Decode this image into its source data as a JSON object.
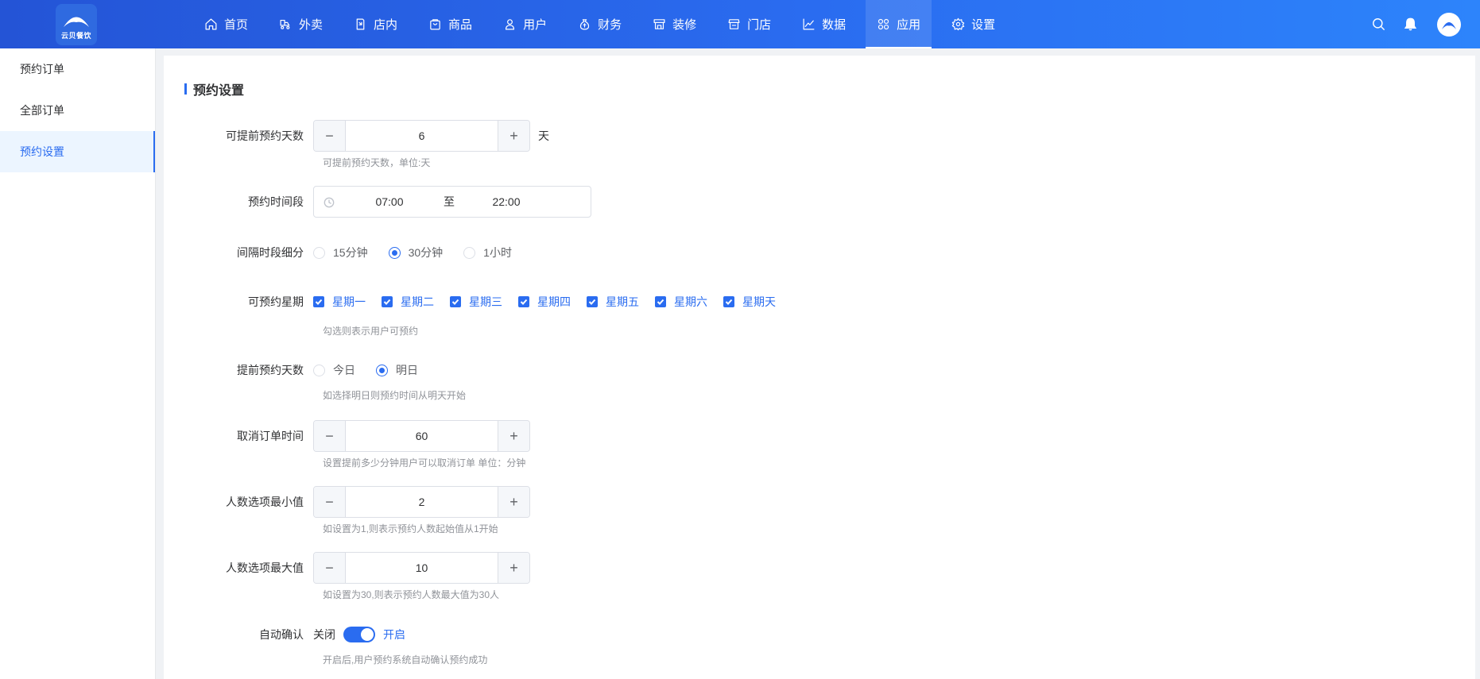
{
  "brand": {
    "logo_text": "云贝餐饮"
  },
  "nav": [
    {
      "label": "首页",
      "icon": "home-icon"
    },
    {
      "label": "外卖",
      "icon": "delivery-icon"
    },
    {
      "label": "店内",
      "icon": "store-icon"
    },
    {
      "label": "商品",
      "icon": "goods-icon"
    },
    {
      "label": "用户",
      "icon": "user-icon"
    },
    {
      "label": "财务",
      "icon": "money-icon"
    },
    {
      "label": "装修",
      "icon": "shop-decor-icon"
    },
    {
      "label": "门店",
      "icon": "branch-icon"
    },
    {
      "label": "数据",
      "icon": "chart-icon"
    },
    {
      "label": "应用",
      "icon": "apps-icon",
      "active": true
    },
    {
      "label": "设置",
      "icon": "gear-icon"
    }
  ],
  "sidebar": {
    "items": [
      {
        "label": "预约订单"
      },
      {
        "label": "全部订单"
      },
      {
        "label": "预约设置",
        "active": true
      }
    ]
  },
  "form": {
    "title": "预约设置",
    "advance_days": {
      "label": "可提前预约天数",
      "value": "6",
      "unit": "天",
      "help": "可提前预约天数，单位:天"
    },
    "time_range": {
      "label": "预约时间段",
      "start": "07:00",
      "separator": "至",
      "end": "22:00"
    },
    "interval": {
      "label": "间隔时段细分",
      "options": [
        "15分钟",
        "30分钟",
        "1小时"
      ],
      "selected": "30分钟"
    },
    "weekdays": {
      "label": "可预约星期",
      "options": [
        "星期一",
        "星期二",
        "星期三",
        "星期四",
        "星期五",
        "星期六",
        "星期天"
      ],
      "help": "勾选则表示用户可预约"
    },
    "start_day": {
      "label": "提前预约天数",
      "options": [
        "今日",
        "明日"
      ],
      "selected": "明日",
      "help": "如选择明日则预约时间从明天开始"
    },
    "cancel_time": {
      "label": "取消订单时间",
      "value": "60",
      "help": "设置提前多少分钟用户可以取消订单 单位：分钟"
    },
    "min_people": {
      "label": "人数选项最小值",
      "value": "2",
      "help": "如设置为1,则表示预约人数起始值从1开始"
    },
    "max_people": {
      "label": "人数选项最大值",
      "value": "10",
      "help": "如设置为30,则表示预约人数最大值为30人"
    },
    "auto_confirm": {
      "label": "自动确认",
      "off_text": "关闭",
      "on_text": "开启",
      "enabled": true,
      "help": "开启后,用户预约系统自动确认预约成功"
    }
  },
  "colors": {
    "primary": "#2a6cf0",
    "topbar_start": "#2454d6",
    "topbar_end": "#2d84fb"
  }
}
